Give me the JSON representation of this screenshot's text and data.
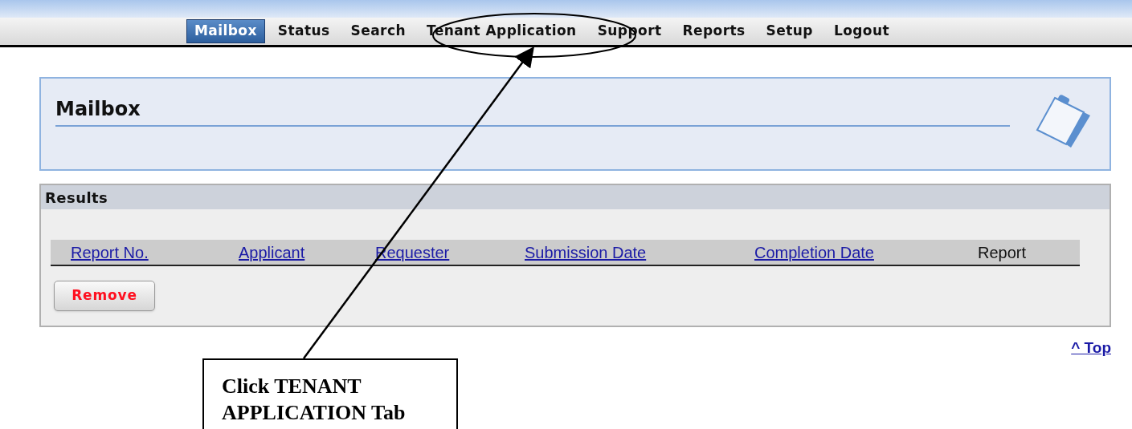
{
  "nav": {
    "tabs": [
      {
        "label": "Mailbox",
        "selected": true
      },
      {
        "label": "Status",
        "selected": false
      },
      {
        "label": "Search",
        "selected": false
      },
      {
        "label": "Tenant Application",
        "selected": false
      },
      {
        "label": "Support",
        "selected": false
      },
      {
        "label": "Reports",
        "selected": false
      },
      {
        "label": "Setup",
        "selected": false
      },
      {
        "label": "Logout",
        "selected": false
      }
    ]
  },
  "header_panel": {
    "title": "Mailbox"
  },
  "results": {
    "title": "Results",
    "columns": [
      {
        "label": "Report No.",
        "kind": "link"
      },
      {
        "label": "Applicant",
        "kind": "link"
      },
      {
        "label": "Requester",
        "kind": "link"
      },
      {
        "label": "Submission Date",
        "kind": "link"
      },
      {
        "label": "Completion Date",
        "kind": "link"
      },
      {
        "label": "Report",
        "kind": "plain"
      }
    ],
    "buttons": [
      "Remove"
    ]
  },
  "top_link": "^ Top",
  "annotation": {
    "text": "Click TENANT APPLICATION Tab"
  }
}
